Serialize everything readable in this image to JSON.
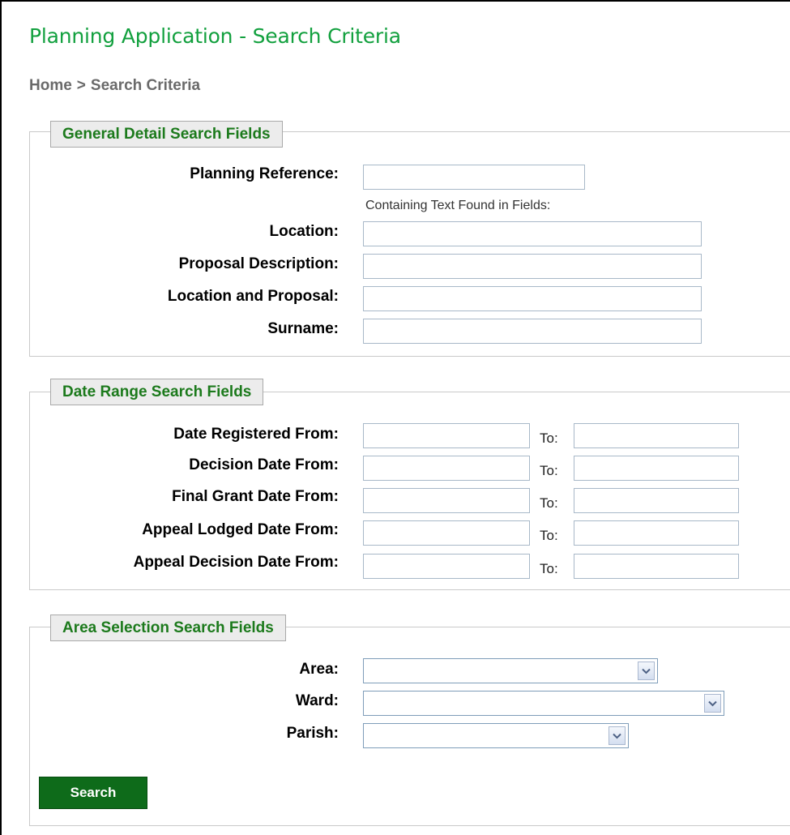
{
  "header": {
    "title": "Planning Application - Search Criteria",
    "breadcrumb": {
      "home": "Home",
      "separator": ">",
      "current": "Search Criteria"
    }
  },
  "general": {
    "legend": "General Detail Search Fields",
    "planning_reference": {
      "label": "Planning Reference:",
      "value": ""
    },
    "containing_text_hint": "Containing Text Found in Fields:",
    "location": {
      "label": "Location:",
      "value": ""
    },
    "proposal_description": {
      "label": "Proposal Description:",
      "value": ""
    },
    "location_and_proposal": {
      "label": "Location and Proposal:",
      "value": ""
    },
    "surname": {
      "label": "Surname:",
      "value": ""
    }
  },
  "dates": {
    "legend": "Date Range Search Fields",
    "to_label": "To:",
    "rows": [
      {
        "label": "Date Registered From:",
        "from": "",
        "to": ""
      },
      {
        "label": "Decision Date From:",
        "from": "",
        "to": ""
      },
      {
        "label": "Final Grant Date From:",
        "from": "",
        "to": ""
      },
      {
        "label": "Appeal Lodged Date From:",
        "from": "",
        "to": ""
      },
      {
        "label": "Appeal Decision Date From:",
        "from": "",
        "to": ""
      }
    ]
  },
  "area": {
    "legend": "Area Selection Search Fields",
    "area": {
      "label": "Area:",
      "selected": ""
    },
    "ward": {
      "label": "Ward:",
      "selected": ""
    },
    "parish": {
      "label": "Parish:",
      "selected": ""
    }
  },
  "actions": {
    "search_label": "Search"
  },
  "icons": {
    "dropdown": "chevron-down-icon"
  },
  "colors": {
    "title_green": "#12a03e",
    "legend_green": "#1c7a1c",
    "button_green": "#0e6b1a",
    "breadcrumb_grey": "#6a6a6a"
  }
}
